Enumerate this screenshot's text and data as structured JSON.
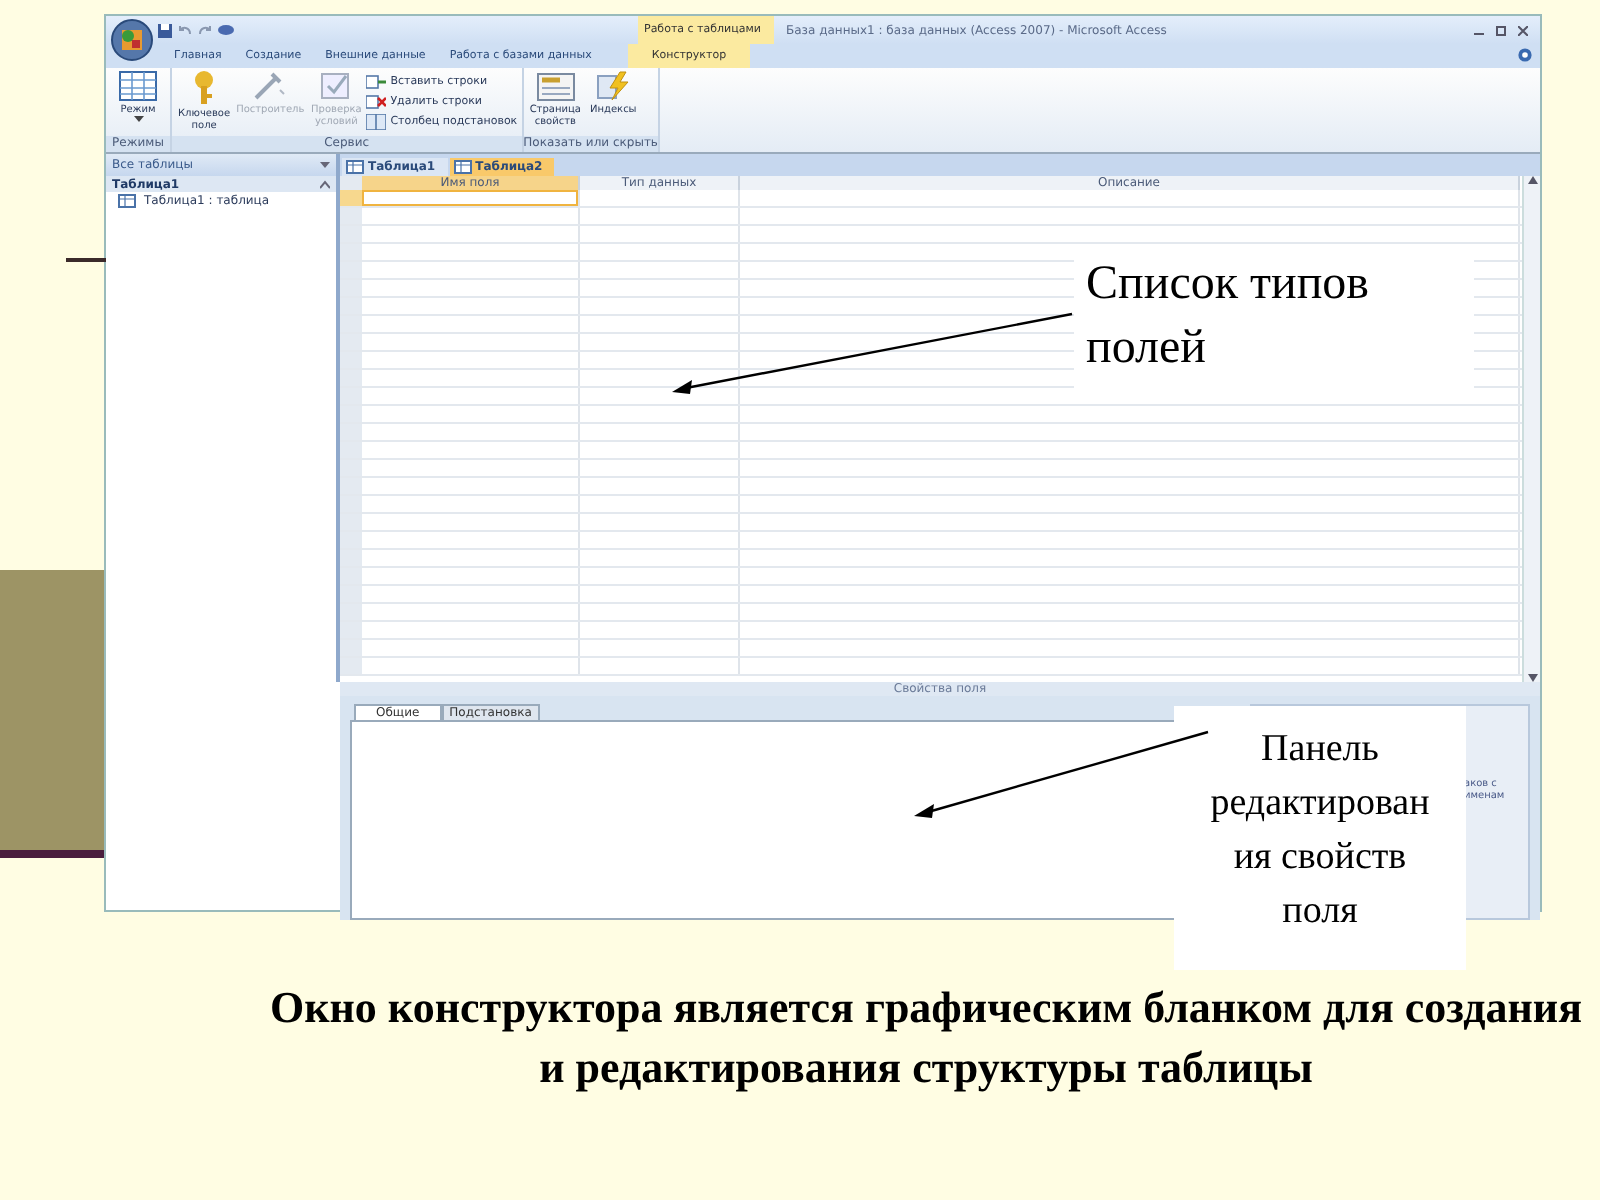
{
  "window": {
    "title": "База данных1 : база данных (Access 2007) - Microsoft Access",
    "contextual_group": "Работа с таблицами"
  },
  "ribbon_tabs": [
    {
      "label": "Главная",
      "selected": false
    },
    {
      "label": "Создание",
      "selected": false
    },
    {
      "label": "Внешние данные",
      "selected": false
    },
    {
      "label": "Работа с базами данных",
      "selected": false
    },
    {
      "label": "Конструктор",
      "selected": true
    }
  ],
  "ribbon_groups": [
    {
      "title": "Режимы",
      "items": [
        {
          "kind": "large",
          "label": "Режим",
          "disabled": false,
          "dropdown": true
        }
      ]
    },
    {
      "title": "Сервис",
      "items": [
        {
          "kind": "large",
          "label": "Ключевое поле",
          "disabled": false,
          "dropdown": false
        },
        {
          "kind": "large",
          "label": "Построитель",
          "disabled": true,
          "dropdown": false
        },
        {
          "kind": "large",
          "label": "Проверка условий",
          "disabled": true,
          "dropdown": false
        },
        {
          "kind": "small",
          "label": "Вставить строки",
          "disabled": false,
          "dropdown": false
        },
        {
          "kind": "small",
          "label": "Удалить строки",
          "disabled": false,
          "dropdown": false
        },
        {
          "kind": "small",
          "label": "Столбец подстановок",
          "disabled": false,
          "dropdown": false
        }
      ]
    },
    {
      "title": "Показать или скрыть",
      "items": [
        {
          "kind": "large",
          "label": "Страница свойств",
          "disabled": false,
          "dropdown": false
        },
        {
          "kind": "large",
          "label": "Индексы",
          "disabled": false,
          "dropdown": false
        }
      ]
    }
  ],
  "nav_pane": {
    "header": "Все таблицы",
    "groups": [
      {
        "label": "Таблица1",
        "items": [
          {
            "label": "Таблица1 : таблица"
          }
        ]
      }
    ]
  },
  "doc_tabs": [
    {
      "label": "Таблица1",
      "selected": false
    },
    {
      "label": "Таблица2",
      "selected": true
    }
  ],
  "grid": {
    "columns": [
      {
        "label": "Имя поля",
        "selected": true
      },
      {
        "label": "Тип данных",
        "selected": false
      },
      {
        "label": "Описание",
        "selected": false
      }
    ]
  },
  "field_properties": {
    "title": "Свойства поля",
    "tabs": [
      {
        "label": "Общие",
        "selected": true
      },
      {
        "label": "Подстановка",
        "selected": false
      }
    ],
    "help_text": [
      "аков с",
      "именам"
    ]
  },
  "callouts": [
    {
      "text": "Список типов полей"
    },
    {
      "text": "Панель редактирования свойств поля"
    }
  ],
  "caption": "Окно конструктора является графическим бланком для создания и редактирования структуры таблицы"
}
